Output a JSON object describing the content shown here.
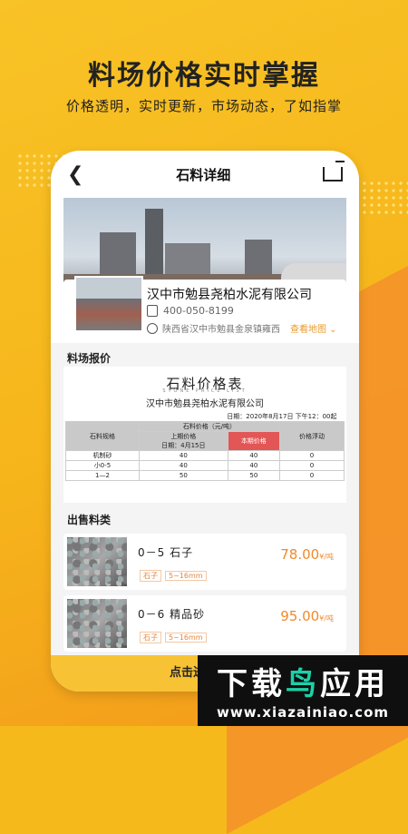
{
  "promo": {
    "headline": "料场价格实时掌握",
    "subline": "价格透明，实时更新，市场动态，了如指掌"
  },
  "nav": {
    "back_icon": "chevron-left-icon",
    "title": "石料详细",
    "share_icon": "share-icon"
  },
  "supplier": {
    "name": "汉中市勉县尧柏水泥有限公司",
    "phone": "400-050-8199",
    "address": "陕西省汉中市勉县金泉镇雍西",
    "map_link": "查看地图"
  },
  "price_section": {
    "title": "料场报价",
    "sheet_title": "石料价格表",
    "sheet_subtitle": "STONE PRICE LIST",
    "sheet_company": "汉中市勉县尧柏水泥有限公司",
    "date": "日期：2020年8月17日 下午12：00起",
    "headers": {
      "spec": "石料规格",
      "price_group": "石料价格（元/吨）",
      "last": "上期价格",
      "last_date": "日期：4月15日",
      "current": "本期价格",
      "change": "价格浮动"
    },
    "rows": [
      {
        "spec": "机制砂",
        "last": "40",
        "current": "40",
        "change": "0"
      },
      {
        "spec": "小0-5",
        "last": "40",
        "current": "40",
        "change": "0"
      },
      {
        "spec": "1—2",
        "last": "50",
        "current": "50",
        "change": "0"
      }
    ]
  },
  "sale_section": {
    "title": "出售料类",
    "products": [
      {
        "name": "0－5 石子",
        "tags": [
          "石子",
          "5~16mm"
        ],
        "price": "78.00",
        "unit": "¥/吨"
      },
      {
        "name": "0－6 精品砂",
        "tags": [
          "石子",
          "5~16mm"
        ],
        "price": "95.00",
        "unit": "¥/吨"
      }
    ]
  },
  "buy_button": "点击进入购买",
  "watermark": {
    "title_a": "下载",
    "title_b": "鸟",
    "title_c": "应用",
    "url": "www.xiazainiao.com"
  },
  "colors": {
    "brand_yellow": "#f6b91c",
    "accent_orange": "#f08a2a",
    "current_price_red": "#e25656"
  }
}
